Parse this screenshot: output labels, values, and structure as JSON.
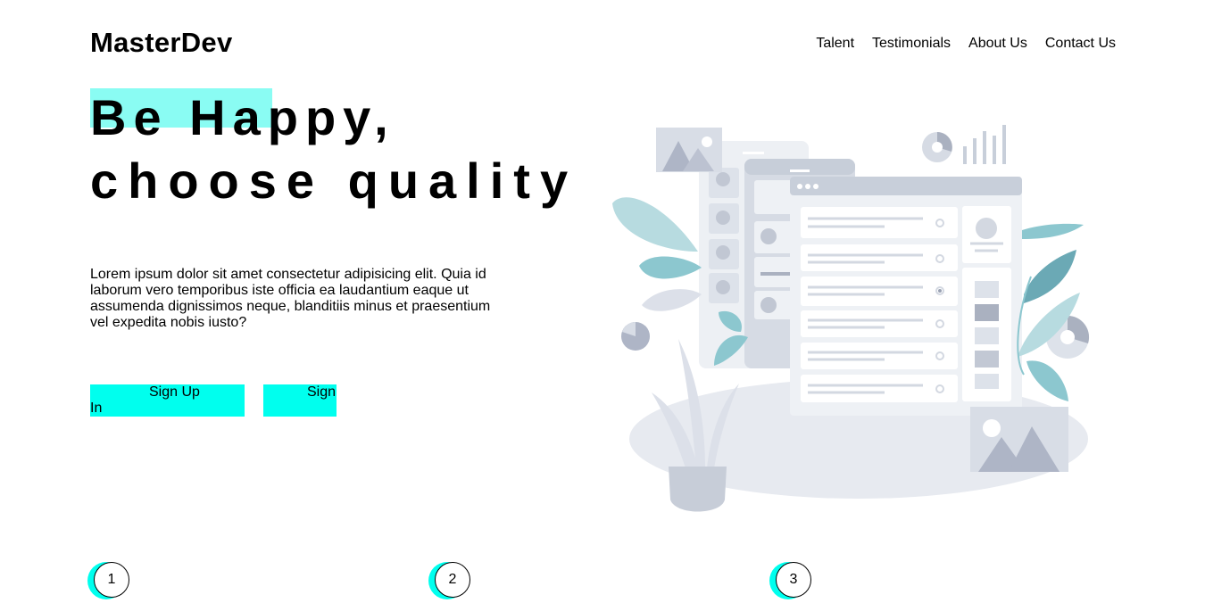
{
  "brand": {
    "name": "MasterDev"
  },
  "nav": {
    "items": [
      "Talent",
      "Testimonials",
      "About Us",
      "Contact Us"
    ]
  },
  "hero": {
    "title_line1": "Be Happy,",
    "title_line2": "choose quality",
    "lead": "Lorem ipsum dolor sit amet consectetur adipisicing elit. Quia id laborum vero temporibus iste officia ea laudantium eaque ut assumenda dignissimos neque, blanditiis minus et praesentium vel expedita nobis iusto?",
    "signup_label": "Sign Up",
    "signin_label_part1": "Sign",
    "signin_label_part2": "In"
  },
  "steps": [
    "1",
    "2",
    "3"
  ],
  "colors": {
    "accent": "#00ffee",
    "highlight": "#8afcf3",
    "illustration_gray": "#c9d0dc",
    "illustration_teal": "#6ba9b5"
  }
}
